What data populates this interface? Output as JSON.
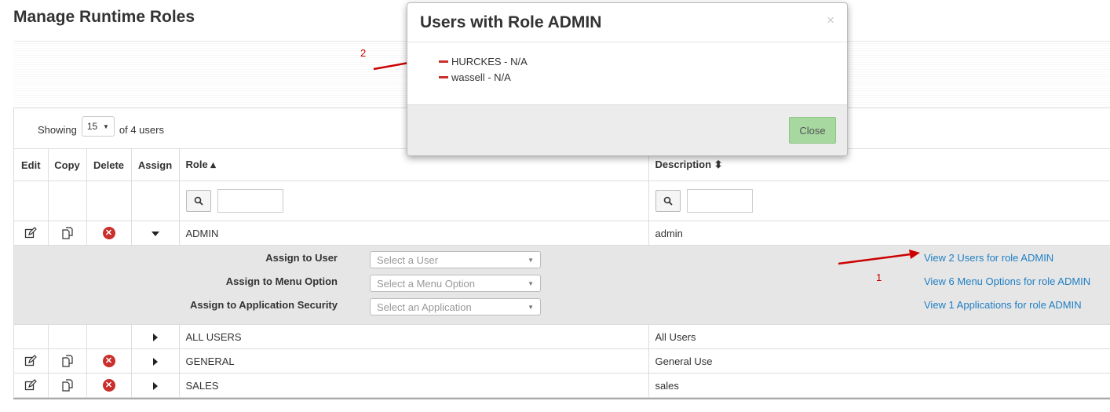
{
  "page": {
    "title": "Manage Runtime Roles"
  },
  "pager": {
    "showing": "Showing",
    "page_size": "15",
    "of_text": "of 4 users"
  },
  "columns": {
    "edit": "Edit",
    "copy": "Copy",
    "delete": "Delete",
    "assign": "Assign",
    "role": "Role ▴",
    "description": "Description ⬍"
  },
  "rows": [
    {
      "role": "ADMIN",
      "description": "admin"
    },
    {
      "role": "ALL USERS",
      "description": "All Users"
    },
    {
      "role": "GENERAL",
      "description": "General Use"
    },
    {
      "role": "SALES",
      "description": "sales"
    }
  ],
  "assign_panel": {
    "user_label": "Assign to User",
    "user_placeholder": "Select a User",
    "menu_label": "Assign to Menu Option",
    "menu_placeholder": "Select a Menu Option",
    "app_label": "Assign to Application Security",
    "app_placeholder": "Select an Application",
    "view_users_link": "View 2 Users for role ADMIN",
    "view_menu_link": "View 6 Menu Options for role ADMIN",
    "view_apps_link": "View 1 Applications for role ADMIN"
  },
  "annotations": {
    "one": "1",
    "two": "2"
  },
  "modal": {
    "title": "Users with Role ADMIN",
    "close_x": "×",
    "users": [
      "HURCKES - N/A",
      "wassell - N/A"
    ],
    "close_button": "Close"
  },
  "colors": {
    "link": "#1f7fc4",
    "delete": "#c9302c",
    "close_button": "#a6d8a0",
    "annotation": "#cc0000"
  }
}
